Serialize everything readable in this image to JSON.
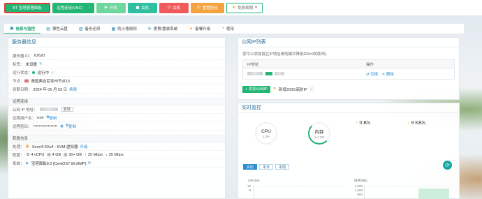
{
  "toolbar": {
    "panel_label": "BT 宝塔管理面板",
    "vnc_label": "远程连接(VNC)",
    "start_label": "开机",
    "stop_label": "关机",
    "poweroff_label": "关机",
    "reset_label": "重置密码",
    "renew_label": "免费续期"
  },
  "tabs": [
    {
      "label": "信息与监控",
      "icon": "monitor-icon"
    },
    {
      "label": "弹性云盘",
      "icon": "disk-icon"
    },
    {
      "label": "备份还原",
      "icon": "backup-icon"
    },
    {
      "label": "防火墙规则",
      "icon": "firewall-icon"
    },
    {
      "label": "更换/重装系统",
      "icon": "reinstall-icon"
    },
    {
      "label": "备餐升级",
      "icon": "upgrade-icon"
    },
    {
      "label": "使用",
      "icon": "chart-icon"
    }
  ],
  "server": {
    "title": "服务器信息",
    "id_label": "服务器 ID：",
    "id_value": "62620",
    "tag_label": "标签：",
    "tag_value": "未设置",
    "status_label": "运行状态：",
    "status_value": "运行中",
    "node_label": "节点：",
    "node_value": "美国弗吉尼亚州节点15",
    "expire_label": "到期日期：",
    "expire_value": "2024 年 05 月 03 日",
    "expire_action": "续费",
    "remote_section": "远程连接",
    "public_ip_label": "公网 IP 地址：",
    "copy_label": "复制",
    "remote_user_label": "远程用户名：",
    "remote_user_value": "root",
    "remote_pass_label": "远程密码：",
    "remote_pass_value": "••••••••••••••••••",
    "config_section": "配置信息",
    "cpu_label": "处理：",
    "cpu_value": "Xeon® E5v4 - KVM 虚拟器",
    "cpu_action": "升级",
    "spec_label": "配置：",
    "spec_vcpu": "4 vCPU",
    "spec_mem": "4 GB",
    "spec_disk": "30+ GB",
    "spec_up": "25 Mbps",
    "spec_down": "35 Mbps",
    "os_label": "系统：",
    "os_value": "宝塔面板8.0 [CentOS7.9/LNMP]"
  },
  "ip_panel": {
    "title": "公网IP列表",
    "desc": "您可以添加独立IP地址来防御并降低DDoS的影响。",
    "col_ip": "IP地址",
    "col_action": "操作",
    "switch_label": "切换",
    "delete_label": "删除",
    "add_label": "+ 添加公网IP",
    "ddos_label": "新增200G高防IP"
  },
  "monitor": {
    "title": "实时监控",
    "cpu_name": "CPU",
    "cpu_value": "1.3%",
    "mem_name": "内存",
    "mem_value": "1.4 GB",
    "up_speed": "0 B/s",
    "down_speed": "9 KB/s",
    "periods": [
      "实时",
      "本日",
      "本周"
    ],
    "cpu_chart_label": "CPU(%)",
    "mem_chart_label": "内存(MB)",
    "cpu_ticks": [
      "10",
      "8"
    ],
    "mem_ticks": [
      "1,500",
      "1,200",
      "900"
    ]
  },
  "colors": {
    "accent": "#22b573",
    "link": "#2b8fd6",
    "danger": "#f15a5a",
    "warning": "#f5a340"
  }
}
